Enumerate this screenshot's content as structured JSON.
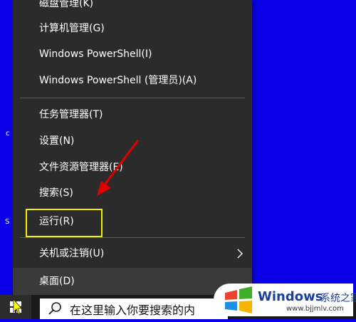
{
  "menu": {
    "items": [
      {
        "label": "磁盘管理(K)",
        "active": false
      },
      {
        "label": "计算机管理(G)",
        "active": false
      },
      {
        "label": "Windows PowerShell(I)",
        "active": false
      },
      {
        "label": "Windows PowerShell (管理员)(A)",
        "active": false
      },
      {
        "label": "任务管理器(T)",
        "active": false
      },
      {
        "label": "设置(N)",
        "active": false
      },
      {
        "label": "文件资源管理器(E)",
        "active": false
      },
      {
        "label": "搜索(S)",
        "active": false
      },
      {
        "label": "运行(R)",
        "active": false
      },
      {
        "label": "关机或注销(U)",
        "active": false
      },
      {
        "label": "桌面(D)",
        "active": true
      }
    ]
  },
  "desktop": {
    "edge_labels": [
      "c",
      "S"
    ]
  },
  "taskbar": {
    "search_text": "在这里输入你要搜索的内"
  },
  "watermark": {
    "brand": "Windows",
    "cn_text": "系统之家",
    "url": "www.bjjmlv.com"
  },
  "colors": {
    "desktop": "#0a00e8",
    "menu_bg": "#2b2b2b",
    "highlight": "#f2f000",
    "arrow": "#e10000"
  }
}
